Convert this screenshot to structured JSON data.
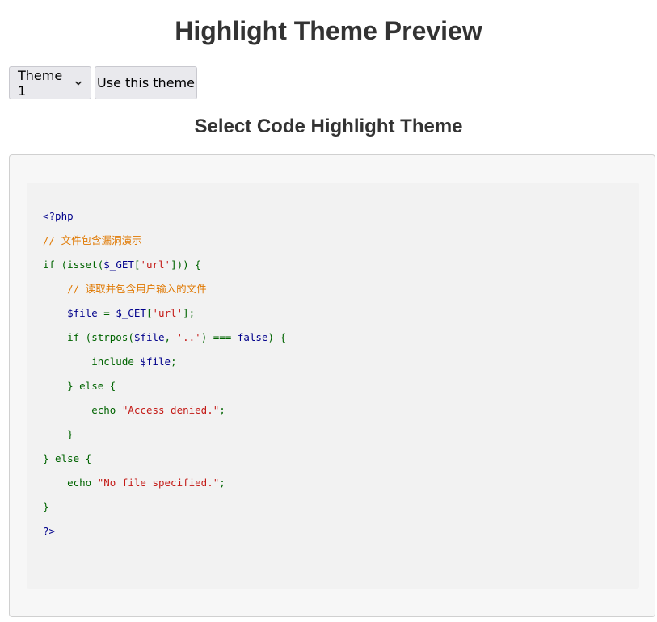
{
  "header": {
    "title": "Highlight Theme Preview"
  },
  "controls": {
    "theme_select_value": "Theme 1",
    "use_button_label": "Use this theme"
  },
  "section": {
    "title": "Select Code Highlight Theme"
  },
  "code": {
    "lines": [
      "<?php",
      "// 文件包含漏洞演示",
      "if (isset($_GET['url'])) {",
      "    // 读取并包含用户输入的文件",
      "    $file = $_GET['url'];",
      "    if (strpos($file, '..') === false) {",
      "        include $file;",
      "    } else {",
      "        echo \"Access denied.\";",
      "    }",
      "} else {",
      "    echo \"No file specified.\";",
      "}",
      "?>"
    ]
  },
  "colors": {
    "keyword": "#006400",
    "variable": "#00008b",
    "string": "#c41a16",
    "comment": "#e07800"
  }
}
